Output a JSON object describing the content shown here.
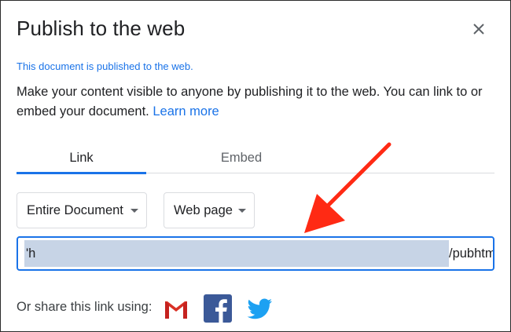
{
  "dialog": {
    "title": "Publish to the web",
    "published_note": "This document is published to the web.",
    "description": "Make your content visible to anyone by publishing it to the web. You can link to or embed your document.",
    "learn_more": "Learn more"
  },
  "tabs": [
    {
      "label": "Link",
      "active": true
    },
    {
      "label": "Embed",
      "active": false
    }
  ],
  "selects": {
    "document": "Entire Document",
    "format": "Web page"
  },
  "url_field": {
    "prefix": "'h",
    "suffix": "/pubhtml"
  },
  "share": {
    "label": "Or share this link using:",
    "icons": [
      "gmail-icon",
      "facebook-icon",
      "twitter-icon"
    ]
  },
  "colors": {
    "accent": "#1a73e8",
    "selection": "#c7d4e6",
    "annotation_arrow": "#ff2a14"
  }
}
